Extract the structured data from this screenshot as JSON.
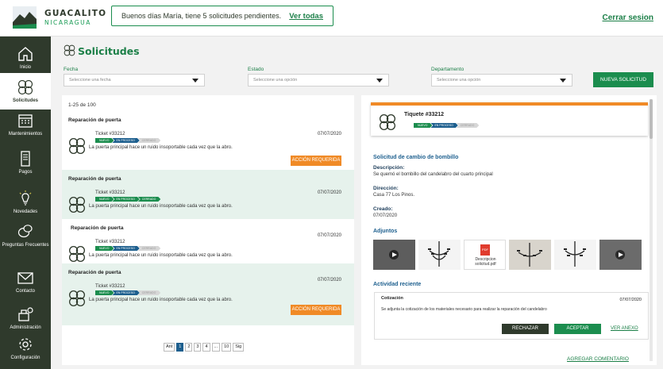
{
  "brand": {
    "line1": "GUACALITO",
    "line2": "NICARAGUA"
  },
  "notice": {
    "message": "Buenos días María, tiene 5 solicitudes pendientes.",
    "link": "Ver todas"
  },
  "header": {
    "logout": "Cerrar sesion"
  },
  "sidebar": {
    "items": [
      {
        "label": "Inicio",
        "icon": "home-icon"
      },
      {
        "label": "Solicitudes",
        "icon": "requests-icon",
        "active": true
      },
      {
        "label": "Mantenimientos",
        "icon": "calendar-icon"
      },
      {
        "label": "Pagos",
        "icon": "receipt-icon"
      },
      {
        "label": "Novedades",
        "icon": "lightbulb-icon"
      },
      {
        "label": "Preguntas Frecuentes",
        "icon": "faq-icon"
      },
      {
        "label": "Contacto",
        "icon": "mail-icon"
      },
      {
        "label": "Administración",
        "icon": "admin-icon"
      },
      {
        "label": "Configuración",
        "icon": "gear-icon"
      }
    ]
  },
  "main": {
    "title": "Solicitudes",
    "filters": [
      {
        "label": "Fecha",
        "placeholder": "Seleccione una fecha"
      },
      {
        "label": "Estado",
        "placeholder": "Seleccione una opción"
      },
      {
        "label": "Departamento",
        "placeholder": "Seleccione una opción"
      }
    ],
    "new_button": "NUEVA SOLICITUD"
  },
  "list": {
    "count": "1-25 de 100",
    "steps": [
      "NUEVO",
      "EN PROCESO",
      "CERRADO"
    ],
    "tickets": [
      {
        "title": "Reparación de puerta",
        "number": "Ticket #33212",
        "date": "07/07/2020",
        "desc": "La puerta principal hace un ruido insoportable cada vez que la abro.",
        "action": "ACCIÓN REQUERIDA",
        "stage": 2
      },
      {
        "title": "Reparación de puerta",
        "number": "Ticket #33212",
        "date": "07/07/2020",
        "desc": "La puerta principal hace un ruido insoportable cada vez que la abro.",
        "action": "",
        "stage": 3
      },
      {
        "title": "Reparación de puerta",
        "number": "Ticket #33212",
        "date": "07/07/2020",
        "desc": "La puerta principal hace un ruido insoportable cada vez que la abro.",
        "action": "",
        "stage": 2
      },
      {
        "title": "Reparación de puerta",
        "number": "Ticket #33212",
        "date": "07/07/2020",
        "desc": "La puerta principal hace un ruido insoportable cada vez que la abro.",
        "action": "ACCIÓN REQUERIDA",
        "stage": 2
      }
    ],
    "pagination": [
      "Ant",
      "1",
      "2",
      "3",
      "4",
      "...",
      "10",
      "Sig"
    ]
  },
  "detail": {
    "ticket": "Tiquete #33212",
    "subject": "Solicitud de cambio de bombillo",
    "desc_label": "Descripción:",
    "desc": "Se quemó el bombillo del candelabro del cuarto principal",
    "addr_label": "Dirección:",
    "addr": "Casa 77 Los Pinos.",
    "created_label": "Creado:",
    "created": "07/07/2020",
    "attachments_label": "Adjuntos",
    "pdf_name": "Descripcion solicitud.pdf",
    "pdf_badge": "PDF",
    "activity_label": "Actividad reciente",
    "activity": {
      "title": "Cotización",
      "date": "07/07/2020",
      "desc": "Se adjunta la cotización de los materiales necesario para realizar la reparación del candelabro",
      "reject": "RECHAZAR",
      "accept": "ACEPTAR",
      "annex": "VER ANEXO"
    },
    "add_comment": "AGREGAR COMENTARIO"
  },
  "colors": {
    "primary": "#1b8d4e",
    "dark": "#2f3a2c",
    "accent": "#f08a26",
    "info": "#1d5f8e",
    "pending": "#d7d7d7"
  }
}
